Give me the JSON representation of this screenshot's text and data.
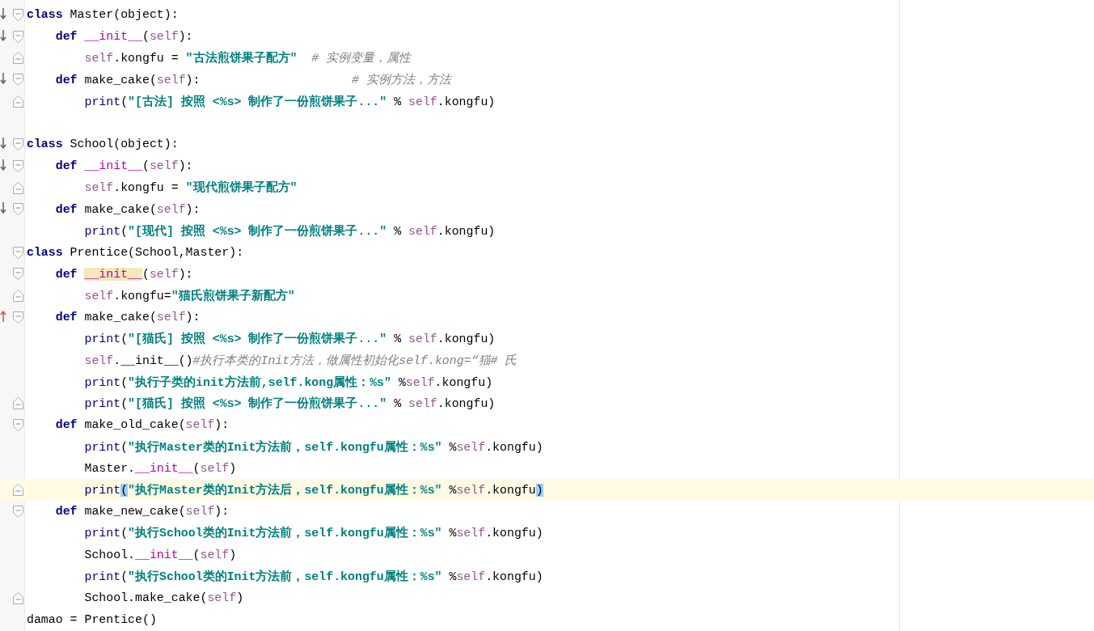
{
  "editor": {
    "lines": [
      {
        "kind": "code",
        "overrides": true,
        "fold_start": true,
        "tokens": [
          {
            "text": "class",
            "kind": "kw"
          },
          {
            "text": " Master(object):",
            "kind": "plain"
          }
        ],
        "children": [
          {
            "kind": "code",
            "overrides": true,
            "fold_start": true,
            "tokens": [
              {
                "text": "def ",
                "kind": "kw"
              },
              {
                "text": "__init__",
                "kind": "magic"
              },
              {
                "text": "(",
                "kind": "plain"
              },
              {
                "text": "self",
                "kind": "self"
              },
              {
                "text": "):",
                "kind": "plain"
              }
            ],
            "children": [
              {
                "kind": "code",
                "fold_end": true,
                "tokens": [
                  {
                    "text": "self",
                    "kind": "self"
                  },
                  {
                    "text": ".kongfu = ",
                    "kind": "plain"
                  },
                  {
                    "text": "\"古法煎饼果子配方\"",
                    "kind": "str"
                  },
                  {
                    "text": "  # 实例变量，属性",
                    "kind": "comment"
                  }
                ]
              }
            ]
          },
          {
            "kind": "code",
            "overrides": true,
            "fold_start": true,
            "tokens": [
              {
                "text": "def ",
                "kind": "kw"
              },
              {
                "text": "make_cake(",
                "kind": "plain"
              },
              {
                "text": "self",
                "kind": "self"
              },
              {
                "text": "):",
                "kind": "plain"
              },
              {
                "text": "                     # 实例方法，方法",
                "kind": "comment"
              }
            ],
            "children": [
              {
                "kind": "code",
                "fold_end": true,
                "tokens": [
                  {
                    "text": "print",
                    "kind": "builtin"
                  },
                  {
                    "text": "(",
                    "kind": "plain"
                  },
                  {
                    "text": "\"[古法] 按照 <%s> 制作了一份煎饼果子...\"",
                    "kind": "str"
                  },
                  {
                    "text": " % ",
                    "kind": "plain"
                  },
                  {
                    "text": "self",
                    "kind": "self"
                  },
                  {
                    "text": ".kongfu)",
                    "kind": "plain"
                  }
                ]
              }
            ]
          }
        ]
      },
      {
        "kind": "blank"
      },
      {
        "kind": "code",
        "overrides": true,
        "fold_start": true,
        "tokens": [
          {
            "text": "class",
            "kind": "kw"
          },
          {
            "text": " School(object):",
            "kind": "plain"
          }
        ],
        "children": [
          {
            "kind": "code",
            "overrides": true,
            "fold_start": true,
            "tokens": [
              {
                "text": "def ",
                "kind": "kw"
              },
              {
                "text": "__init__",
                "kind": "magic"
              },
              {
                "text": "(",
                "kind": "plain"
              },
              {
                "text": "self",
                "kind": "self"
              },
              {
                "text": "):",
                "kind": "plain"
              }
            ],
            "children": [
              {
                "kind": "code",
                "fold_end": true,
                "tokens": [
                  {
                    "text": "self",
                    "kind": "self"
                  },
                  {
                    "text": ".kongfu = ",
                    "kind": "plain"
                  },
                  {
                    "text": "\"现代煎饼果子配方\"",
                    "kind": "str"
                  }
                ]
              }
            ]
          },
          {
            "kind": "code",
            "overrides": true,
            "fold_start": true,
            "tokens": [
              {
                "text": "def ",
                "kind": "kw"
              },
              {
                "text": "make_cake(",
                "kind": "plain"
              },
              {
                "text": "self",
                "kind": "self"
              },
              {
                "text": "):",
                "kind": "plain"
              }
            ],
            "children": [
              {
                "kind": "code",
                "tokens": [
                  {
                    "text": "print",
                    "kind": "builtin"
                  },
                  {
                    "text": "(",
                    "kind": "plain"
                  },
                  {
                    "text": "\"[现代] 按照 <%s> 制作了一份煎饼果子...\"",
                    "kind": "str"
                  },
                  {
                    "text": " % ",
                    "kind": "plain"
                  },
                  {
                    "text": "self",
                    "kind": "self"
                  },
                  {
                    "text": ".kongfu)",
                    "kind": "plain"
                  }
                ]
              }
            ]
          }
        ]
      },
      {
        "kind": "code",
        "fold_start": true,
        "tokens": [
          {
            "text": "class",
            "kind": "kw"
          },
          {
            "text": " Prentice(School,Master):",
            "kind": "plain"
          }
        ],
        "children": [
          {
            "kind": "code",
            "fold_start": true,
            "tokens": [
              {
                "text": "def ",
                "kind": "kw"
              },
              {
                "text": "__init__",
                "kind": "magic",
                "highlight": true
              },
              {
                "text": "(",
                "kind": "plain"
              },
              {
                "text": "self",
                "kind": "self"
              },
              {
                "text": "):",
                "kind": "plain"
              }
            ],
            "children": [
              {
                "kind": "code",
                "fold_end": true,
                "tokens": [
                  {
                    "text": "self",
                    "kind": "self"
                  },
                  {
                    "text": ".kongfu=",
                    "kind": "plain"
                  },
                  {
                    "text": "\"猫氏煎饼果子新配方\"",
                    "kind": "str"
                  }
                ]
              }
            ]
          },
          {
            "kind": "code",
            "overridden": true,
            "fold_start": true,
            "tokens": [
              {
                "text": "def ",
                "kind": "kw"
              },
              {
                "text": "make_cake(",
                "kind": "plain"
              },
              {
                "text": "self",
                "kind": "self"
              },
              {
                "text": "):",
                "kind": "plain"
              }
            ],
            "children": [
              {
                "kind": "code",
                "tokens": [
                  {
                    "text": "print",
                    "kind": "builtin"
                  },
                  {
                    "text": "(",
                    "kind": "plain"
                  },
                  {
                    "text": "\"[猫氏] 按照 <%s> 制作了一份煎饼果子...\"",
                    "kind": "str"
                  },
                  {
                    "text": " % ",
                    "kind": "plain"
                  },
                  {
                    "text": "self",
                    "kind": "self"
                  },
                  {
                    "text": ".kongfu)",
                    "kind": "plain"
                  }
                ]
              },
              {
                "kind": "code",
                "tokens": [
                  {
                    "text": "self",
                    "kind": "self"
                  },
                  {
                    "text": ".__init__()",
                    "kind": "plain"
                  },
                  {
                    "text": "#执行本类的Init方法，做属性初始化self.kong=“猫# 氏",
                    "kind": "comment"
                  }
                ]
              },
              {
                "kind": "code",
                "tokens": [
                  {
                    "text": "print",
                    "kind": "builtin"
                  },
                  {
                    "text": "(",
                    "kind": "plain"
                  },
                  {
                    "text": "\"执行子类的init方法前,self.kong属性：%s\"",
                    "kind": "str"
                  },
                  {
                    "text": " %",
                    "kind": "plain"
                  },
                  {
                    "text": "self",
                    "kind": "self"
                  },
                  {
                    "text": ".kongfu)",
                    "kind": "plain"
                  }
                ]
              },
              {
                "kind": "code",
                "fold_end": true,
                "tokens": [
                  {
                    "text": "print",
                    "kind": "builtin"
                  },
                  {
                    "text": "(",
                    "kind": "plain"
                  },
                  {
                    "text": "\"[猫氏] 按照 <%s> 制作了一份煎饼果子...\"",
                    "kind": "str"
                  },
                  {
                    "text": " % ",
                    "kind": "plain"
                  },
                  {
                    "text": "self",
                    "kind": "self"
                  },
                  {
                    "text": ".kongfu)",
                    "kind": "plain"
                  }
                ]
              }
            ]
          },
          {
            "kind": "code",
            "fold_start": true,
            "tokens": [
              {
                "text": "def ",
                "kind": "kw"
              },
              {
                "text": "make_old_cake(",
                "kind": "plain"
              },
              {
                "text": "self",
                "kind": "self"
              },
              {
                "text": "):",
                "kind": "plain"
              }
            ],
            "children": [
              {
                "kind": "code",
                "tokens": [
                  {
                    "text": "print",
                    "kind": "builtin"
                  },
                  {
                    "text": "(",
                    "kind": "plain"
                  },
                  {
                    "text": "\"执行Master类的Init方法前，self.kongfu属性：%s\"",
                    "kind": "str"
                  },
                  {
                    "text": " %",
                    "kind": "plain"
                  },
                  {
                    "text": "self",
                    "kind": "self"
                  },
                  {
                    "text": ".kongfu)",
                    "kind": "plain"
                  }
                ]
              },
              {
                "kind": "code",
                "tokens": [
                  {
                    "text": "Master.",
                    "kind": "plain"
                  },
                  {
                    "text": "__init__",
                    "kind": "magic"
                  },
                  {
                    "text": "(",
                    "kind": "plain"
                  },
                  {
                    "text": "self",
                    "kind": "self"
                  },
                  {
                    "text": ")",
                    "kind": "plain"
                  }
                ]
              },
              {
                "kind": "code",
                "fold_end": true,
                "current": true,
                "tokens": [
                  {
                    "text": "print",
                    "kind": "builtin"
                  },
                  {
                    "text": "(",
                    "kind": "plain",
                    "highlight": true
                  },
                  {
                    "text": "\"执行Master类的Init方法后，self.kongfu属性：%s\"",
                    "kind": "str"
                  },
                  {
                    "text": " %",
                    "kind": "plain"
                  },
                  {
                    "text": "self",
                    "kind": "self"
                  },
                  {
                    "text": ".kongfu",
                    "kind": "plain"
                  },
                  {
                    "text": ")",
                    "kind": "plain",
                    "highlight": true
                  }
                ]
              }
            ]
          },
          {
            "kind": "code",
            "fold_start": true,
            "tokens": [
              {
                "text": "def ",
                "kind": "kw"
              },
              {
                "text": "make_new_cake(",
                "kind": "plain"
              },
              {
                "text": "self",
                "kind": "self"
              },
              {
                "text": "):",
                "kind": "plain"
              }
            ],
            "children": [
              {
                "kind": "code",
                "tokens": [
                  {
                    "text": "print",
                    "kind": "builtin"
                  },
                  {
                    "text": "(",
                    "kind": "plain"
                  },
                  {
                    "text": "\"执行School类的Init方法前，self.kongfu属性：%s\"",
                    "kind": "str"
                  },
                  {
                    "text": " %",
                    "kind": "plain"
                  },
                  {
                    "text": "self",
                    "kind": "self"
                  },
                  {
                    "text": ".kongfu)",
                    "kind": "plain"
                  }
                ]
              },
              {
                "kind": "code",
                "tokens": [
                  {
                    "text": "School.",
                    "kind": "plain"
                  },
                  {
                    "text": "__init__",
                    "kind": "magic"
                  },
                  {
                    "text": "(",
                    "kind": "plain"
                  },
                  {
                    "text": "self",
                    "kind": "self"
                  },
                  {
                    "text": ")",
                    "kind": "plain"
                  }
                ]
              },
              {
                "kind": "code",
                "tokens": [
                  {
                    "text": "print",
                    "kind": "builtin"
                  },
                  {
                    "text": "(",
                    "kind": "plain"
                  },
                  {
                    "text": "\"执行School类的Init方法前，self.kongfu属性：%s\"",
                    "kind": "str"
                  },
                  {
                    "text": " %",
                    "kind": "plain"
                  },
                  {
                    "text": "self",
                    "kind": "self"
                  },
                  {
                    "text": ".kongfu)",
                    "kind": "plain"
                  }
                ]
              },
              {
                "kind": "code",
                "fold_end": true,
                "tokens": [
                  {
                    "text": "School.make_cake(",
                    "kind": "plain"
                  },
                  {
                    "text": "self",
                    "kind": "self"
                  },
                  {
                    "text": ")",
                    "kind": "plain"
                  }
                ]
              }
            ]
          }
        ]
      },
      {
        "kind": "code",
        "tokens": [
          {
            "text": "damao = Prentice()",
            "kind": "plain"
          }
        ]
      }
    ]
  }
}
